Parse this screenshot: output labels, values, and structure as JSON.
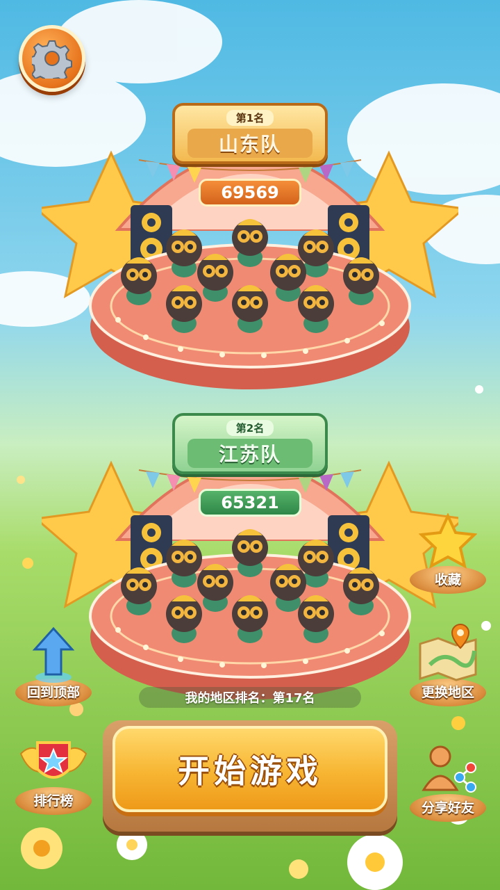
{
  "header": {
    "settings_icon": "gear-icon"
  },
  "leaderboard": [
    {
      "rank_label": "第1名",
      "team": "山东队",
      "score": "69569",
      "theme": "gold",
      "accent": "#e6731c"
    },
    {
      "rank_label": "第2名",
      "team": "江苏队",
      "score": "65321",
      "theme": "green",
      "accent": "#3b8a4c"
    }
  ],
  "my_rank": "我的地区排名：第17名",
  "start_button": "开始游戏",
  "side_buttons": {
    "favorite": {
      "label": "收藏",
      "icon": "star-icon"
    },
    "change_region": {
      "label": "更换地区",
      "icon": "map-icon"
    },
    "back_to_top": {
      "label": "回到顶部",
      "icon": "arrow-up-icon"
    },
    "ranking": {
      "label": "排行榜",
      "icon": "badge-icon"
    },
    "share": {
      "label": "分享好友",
      "icon": "share-icon"
    }
  },
  "colors": {
    "sky": "#63c4e6",
    "grass": "#8fcf4a",
    "stage": "#f08a73",
    "start": "#f7b532"
  }
}
